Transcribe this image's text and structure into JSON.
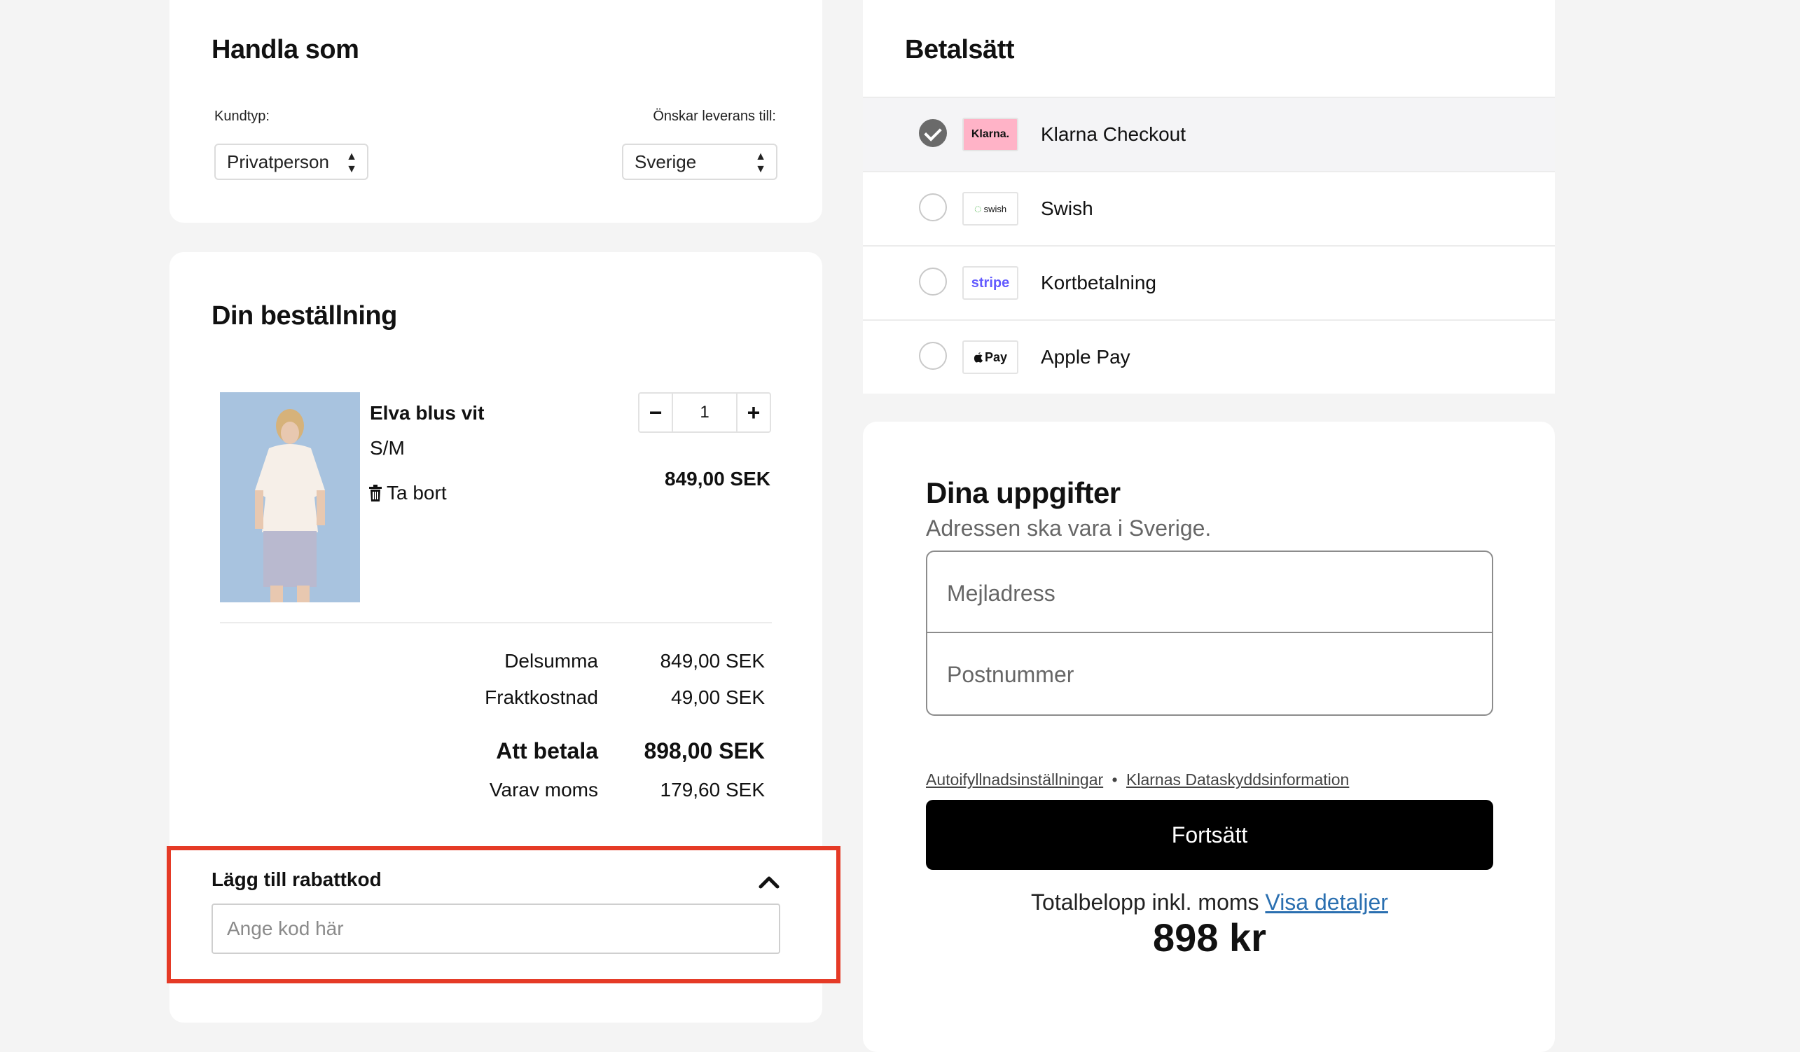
{
  "shop_as": {
    "title": "Handla som",
    "customer_type_label": "Kundtyp:",
    "customer_type_value": "Privatperson",
    "delivery_label": "Önskar leverans till:",
    "delivery_value": "Sverige"
  },
  "order": {
    "title": "Din beställning",
    "item": {
      "name": "Elva blus vit",
      "size": "S/M",
      "remove_label": "Ta bort",
      "quantity": "1",
      "price": "849,00 SEK"
    },
    "summary": {
      "subtotal_label": "Delsumma",
      "subtotal_value": "849,00 SEK",
      "shipping_label": "Fraktkostnad",
      "shipping_value": "49,00 SEK",
      "total_label": "Att betala",
      "total_value": "898,00 SEK",
      "vat_label": "Varav moms",
      "vat_value": "179,60 SEK"
    }
  },
  "discount": {
    "title": "Lägg till rabattkod",
    "placeholder": "Ange kod här"
  },
  "payment": {
    "title": "Betalsätt",
    "methods": [
      {
        "name": "Klarna Checkout",
        "logo_text": "Klarna.",
        "selected": true
      },
      {
        "name": "Swish",
        "logo_text": "swish",
        "selected": false
      },
      {
        "name": "Kortbetalning",
        "logo_text": "stripe",
        "selected": false
      },
      {
        "name": "Apple Pay",
        "logo_text": "Pay",
        "selected": false
      }
    ]
  },
  "details": {
    "title": "Dina uppgifter",
    "subtitle": "Adressen ska vara i Sverige.",
    "email_placeholder": "Mejladress",
    "postcode_placeholder": "Postnummer",
    "autofill_link": "Autoifyllnadsinställningar",
    "separator": "•",
    "privacy_link": "Klarnas Dataskyddsinformation",
    "continue_label": "Fortsätt",
    "total_prefix": "Totalbelopp inkl. moms",
    "details_link": "Visa detaljer",
    "total_amount": "898 kr"
  },
  "colors": {
    "highlight_border": "#e53a26",
    "klarna_pink": "#ffb3c7",
    "stripe_purple": "#635bff",
    "button_black": "#000000"
  }
}
